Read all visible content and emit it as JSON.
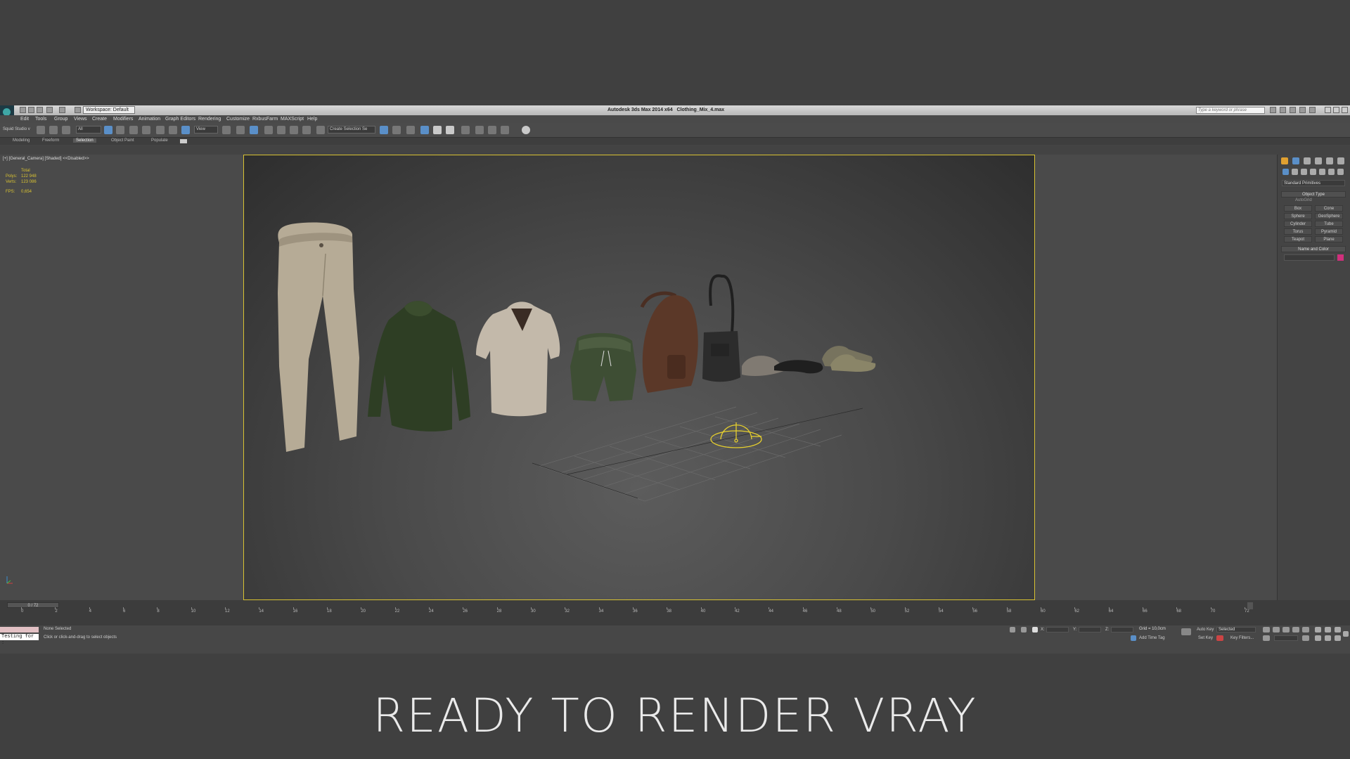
{
  "titlebar": {
    "app_title": "Autodesk 3ds Max 2014 x64",
    "file_name": "Clothing_Mix_4.max",
    "workspace": "Workspace: Default",
    "search_placeholder": "Type a keyword or phrase"
  },
  "menu": [
    "Edit",
    "Tools",
    "Group",
    "Views",
    "Create",
    "Modifiers",
    "Animation",
    "Graph Editors",
    "Rendering",
    "Customize",
    "RxbusFarm",
    "MAXScript",
    "Help"
  ],
  "toolbar": {
    "studio_label": "Squid Studio v",
    "filter_dropdown": "All",
    "ref_coord_dropdown": "View",
    "selection_set_dropdown": "Create Selection Se"
  },
  "ribbon_tabs": [
    "Modeling",
    "Freeform",
    "Selection",
    "Object Paint",
    "Populate"
  ],
  "ribbon_active": "Selection",
  "viewport": {
    "label": "[+] [General_Camera] [Shaded]  <<Disabled>>",
    "stats_header": "Total",
    "polys_label": "Polys:",
    "polys_value": "122 948",
    "verts_label": "Verts:",
    "verts_value": "123 086",
    "fps_label": "FPS:",
    "fps_value": "0,654"
  },
  "command_panel": {
    "category": "Standard Primitives",
    "object_type_title": "Object Type",
    "autogrid_label": "AutoGrid",
    "buttons": [
      "Box",
      "Cone",
      "Sphere",
      "GeoSphere",
      "Cylinder",
      "Tube",
      "Torus",
      "Pyramid",
      "Teapot",
      "Plane"
    ],
    "name_color_title": "Name and Color",
    "swatch_color": "#d0307c"
  },
  "timeline": {
    "frame_counter": "0 / 72",
    "ticks": [
      "0",
      "2",
      "4",
      "6",
      "8",
      "10",
      "12",
      "14",
      "16",
      "18",
      "20",
      "22",
      "24",
      "26",
      "28",
      "30",
      "32",
      "34",
      "36",
      "38",
      "40",
      "42",
      "44",
      "46",
      "48",
      "50",
      "52",
      "54",
      "56",
      "58",
      "60",
      "62",
      "64",
      "66",
      "68",
      "70",
      "72"
    ]
  },
  "status": {
    "maxscript_input": "Testing for :",
    "selection_status": "None Selected",
    "prompt": "Click or click-and-drag to select objects",
    "x_label": "X:",
    "y_label": "Y:",
    "z_label": "Z:",
    "grid": "Grid = 10,0cm",
    "add_time_tag": "Add Time Tag",
    "auto_key": "Auto Key",
    "set_key": "Set Key",
    "key_mode": "Selected",
    "key_filters": "Key Filters..."
  },
  "caption": "READY TO RENDER VRAY",
  "colors": {
    "viewport_border": "#d8c232",
    "helper_wire": "#e6cf2e"
  }
}
